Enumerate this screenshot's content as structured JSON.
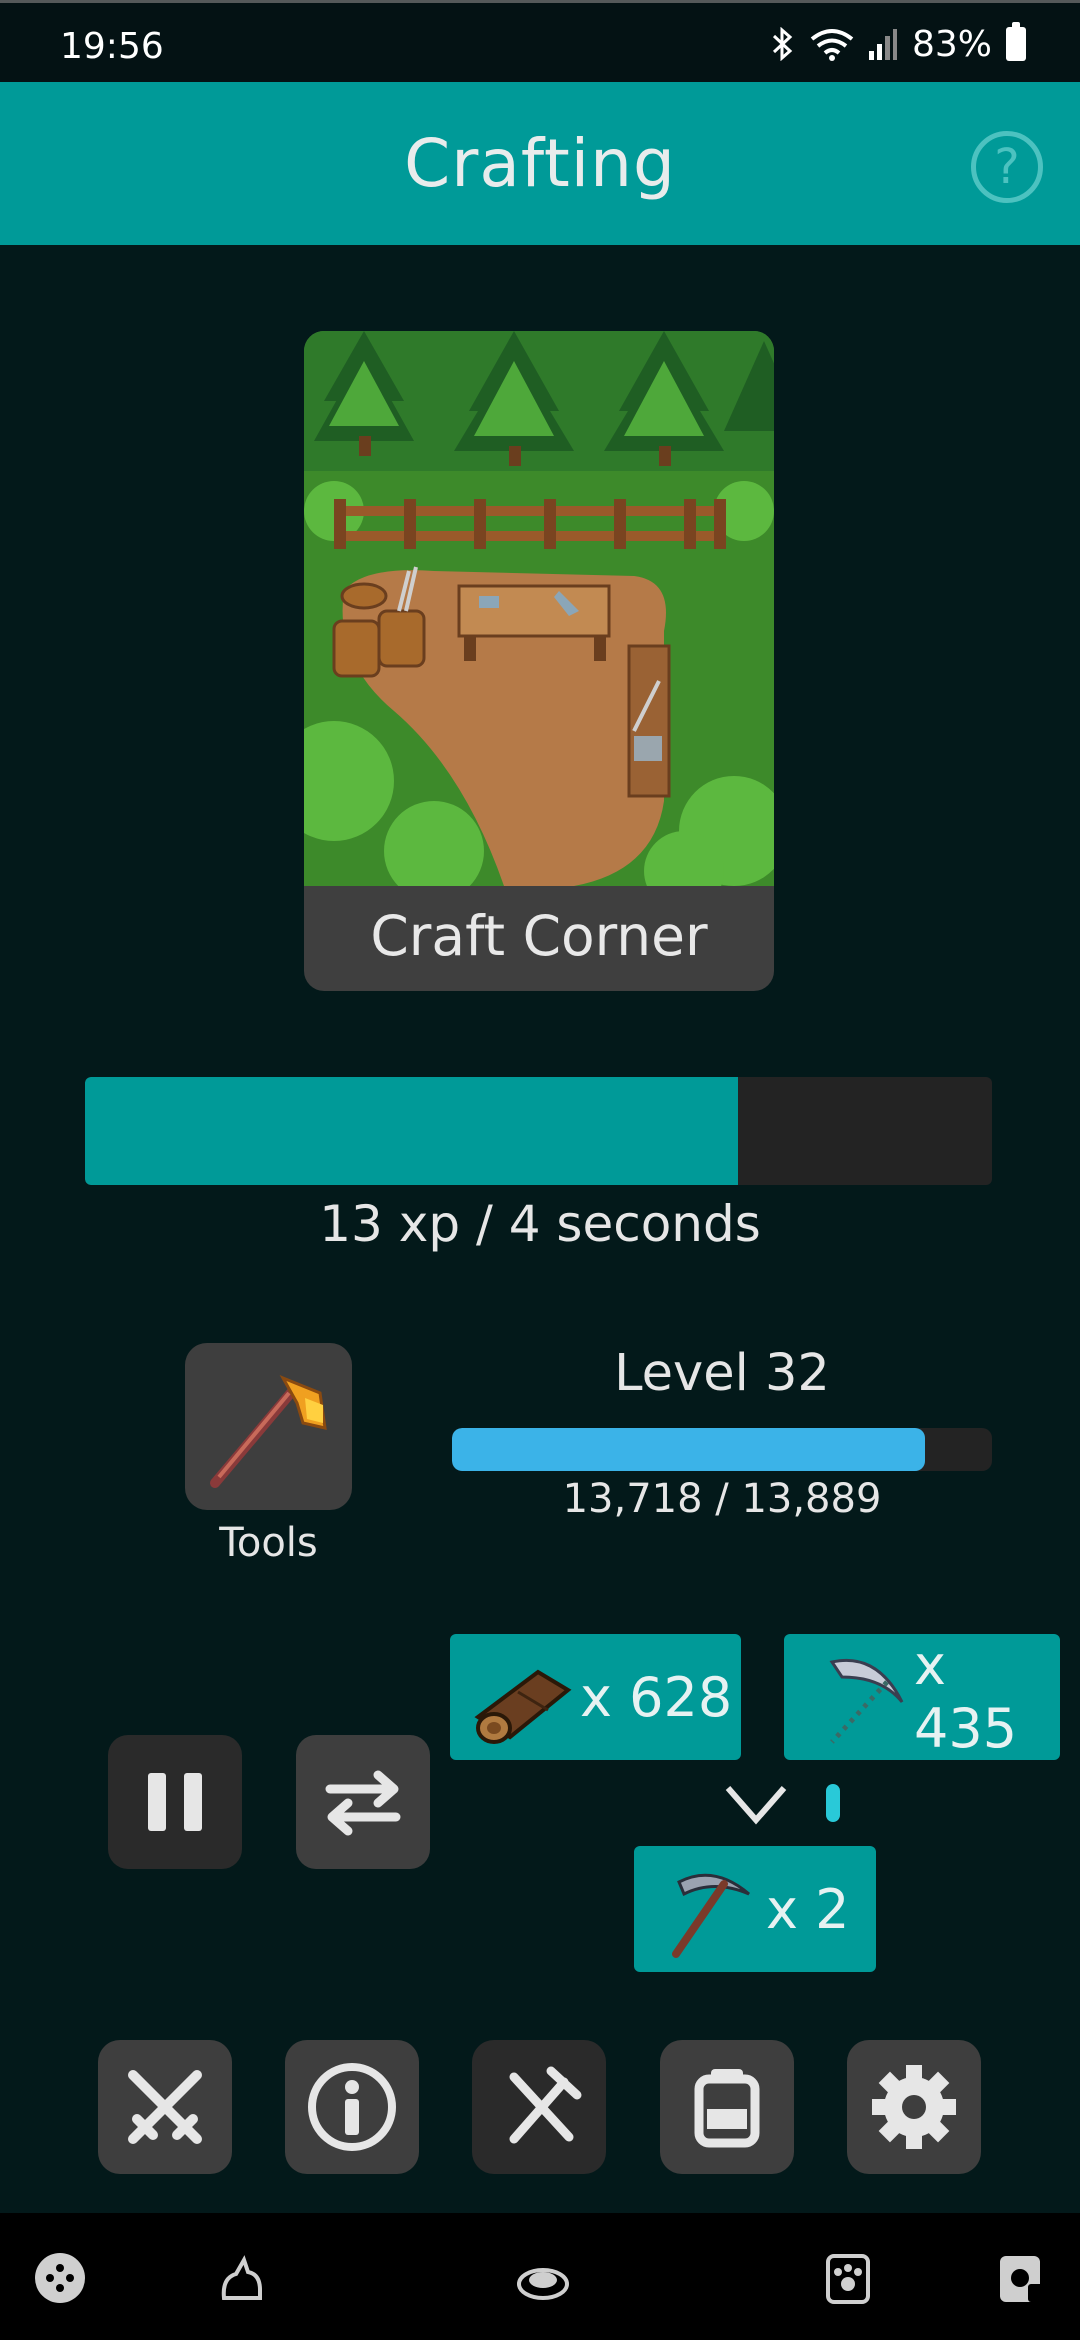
{
  "status_bar": {
    "time": "19:56",
    "battery": "83%",
    "icons": [
      "bluetooth-icon",
      "wifi-icon",
      "signal-icon",
      "battery-icon"
    ]
  },
  "header": {
    "title": "Crafting",
    "help_label": "?"
  },
  "location": {
    "name": "Craft Corner",
    "image": "craft-corner-scene"
  },
  "action": {
    "progress_fraction": 0.72,
    "rate_text": "13 xp / 4 seconds"
  },
  "skill": {
    "tools_label": "Tools",
    "tool_icon": "axe-icon",
    "level_text": "Level 32",
    "xp_text": "13,718 / 13,889",
    "level_fraction": 0.876
  },
  "recipe": {
    "ingredients": [
      {
        "icon": "log-icon",
        "qty": "x 628"
      },
      {
        "icon": "scythe-icon",
        "qty": "x 435"
      }
    ],
    "product": {
      "icon": "pickaxe-icon",
      "qty": "x 2"
    }
  },
  "controls": {
    "pause_icon": "pause-icon",
    "swap_icon": "swap-icon"
  },
  "bottom_nav": [
    "combat-swords-icon",
    "info-icon",
    "crafting-hammer-icon",
    "backpack-icon",
    "gear-icon"
  ],
  "system_nav": [
    "game-controller-icon",
    "cat-icon",
    "cat-bed-icon",
    "paw-icon",
    "pet-card-icon"
  ],
  "colors": {
    "accent": "#009a98",
    "background": "#03191a",
    "level_bar": "#3bb3e8",
    "button": "#3e3e3e"
  }
}
